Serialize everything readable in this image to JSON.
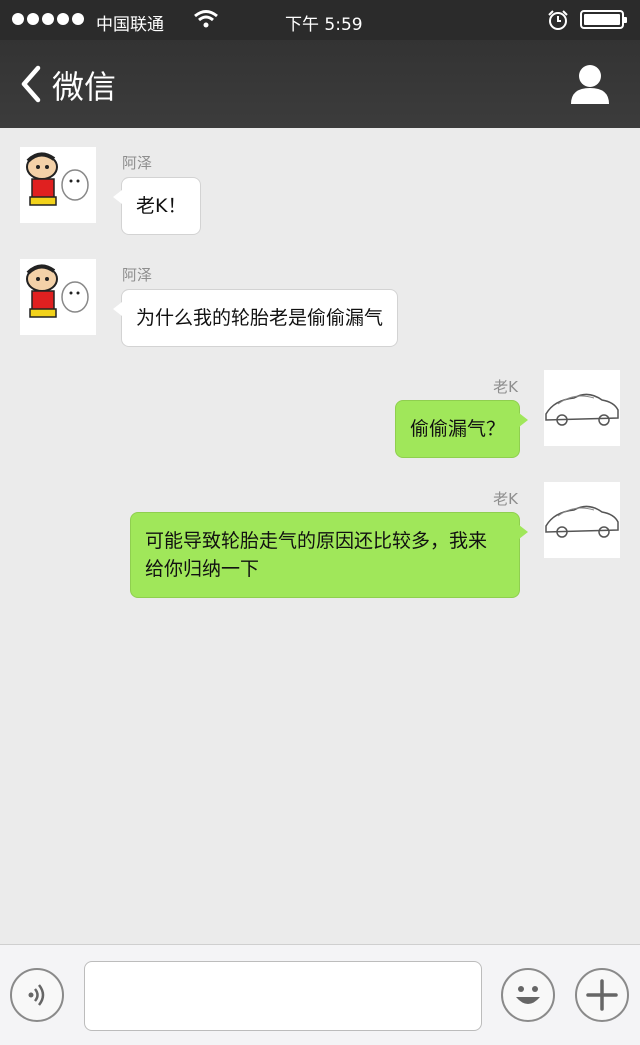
{
  "status_bar": {
    "carrier": "中国联通",
    "time": "下午 5:59",
    "signal_icon": "signal-dots-icon",
    "wifi_icon": "wifi-icon",
    "alarm_icon": "alarm-icon",
    "battery_icon": "battery-icon"
  },
  "nav": {
    "back_label": "微信",
    "back_icon": "chevron-left-icon",
    "profile_icon": "person-icon"
  },
  "messages": [
    {
      "sender": "阿泽",
      "direction": "incoming",
      "text": "老K！",
      "avatar": "cartoon-boy-avatar"
    },
    {
      "sender": "阿泽",
      "direction": "incoming",
      "text": "为什么我的轮胎老是偷偷漏气",
      "avatar": "cartoon-boy-avatar"
    },
    {
      "sender": "老K",
      "direction": "outgoing",
      "text": "偷偷漏气？",
      "avatar": "car-sketch-avatar"
    },
    {
      "sender": "老K",
      "direction": "outgoing",
      "text": "可能导致轮胎走气的原因还比较多，我来给你归纳一下",
      "avatar": "car-sketch-avatar"
    }
  ],
  "input_bar": {
    "voice_icon": "voice-icon",
    "emoji_icon": "smiley-icon",
    "plus_icon": "plus-icon",
    "text_value": ""
  },
  "colors": {
    "outgoing_bubble": "#a0e75a",
    "incoming_bubble": "#ffffff",
    "nav_bg": "#363636",
    "chat_bg": "#ebebeb"
  }
}
